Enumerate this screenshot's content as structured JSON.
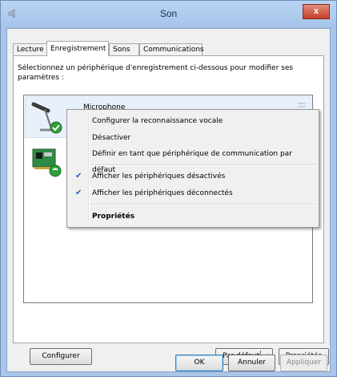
{
  "window": {
    "title": "Son",
    "close_label": "x"
  },
  "tabs": [
    "Lecture",
    "Enregistrement",
    "Sons",
    "Communications"
  ],
  "panel": {
    "instructions": "Sélectionnez un périphérique d'enregistrement ci-dessous pour modifier ses paramètres :"
  },
  "devices": [
    {
      "name": "Microphone",
      "icon": "microphone-icon",
      "status": "default-device-check"
    },
    {
      "name": "",
      "icon": "sound-card-icon",
      "status": "communication-device-phone"
    }
  ],
  "context_menu": {
    "items": [
      {
        "label": "Configurer la reconnaissance vocale",
        "checked": false
      },
      {
        "label": "Désactiver",
        "checked": false
      },
      {
        "label": "Définir en tant que périphérique de communication par défaut",
        "checked": false
      },
      {
        "label": "Afficher les périphériques désactivés",
        "checked": true
      },
      {
        "label": "Afficher les périphériques déconnectés",
        "checked": true
      },
      {
        "label": "Propriétés",
        "checked": false,
        "bold": true
      }
    ]
  },
  "panel_buttons": {
    "configure": "Configurer",
    "set_default": "Par défaut",
    "properties": "Propriétés"
  },
  "dialog_buttons": {
    "ok": "OK",
    "cancel": "Annuler",
    "apply": "Appliquer"
  },
  "colors": {
    "frame": "#a9c6ea",
    "close": "#c7402a",
    "check": "#2a5bb5",
    "green_badge": "#2e9e3a"
  }
}
